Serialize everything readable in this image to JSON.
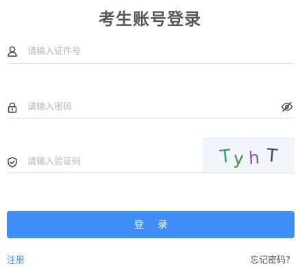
{
  "title": "考生账号登录",
  "fields": {
    "id_number": {
      "placeholder": "请输入证件号",
      "value": ""
    },
    "password": {
      "placeholder": "请输入密码",
      "value": ""
    },
    "captcha": {
      "placeholder": "请输入验证码",
      "value": ""
    }
  },
  "captcha_image": {
    "chars": [
      "T",
      "y",
      "h",
      "T"
    ],
    "colors": [
      "#2f9e6e",
      "#4f8a3a",
      "#8a4fc0",
      "#3e4a6a"
    ]
  },
  "buttons": {
    "login_label": "登 录"
  },
  "links": {
    "register": "注册",
    "forgot_password": "忘记密码?"
  },
  "icons": {
    "id_field": "user-icon",
    "password_field": "lock-icon",
    "password_toggle": "eye-slash-icon",
    "captcha_field": "shield-check-icon"
  },
  "colors": {
    "primary": "#3f8ef6",
    "title": "#545660",
    "border": "#dcdfe6",
    "placeholder": "#b0b3b9",
    "captcha_bg": "#f2f5f9"
  }
}
